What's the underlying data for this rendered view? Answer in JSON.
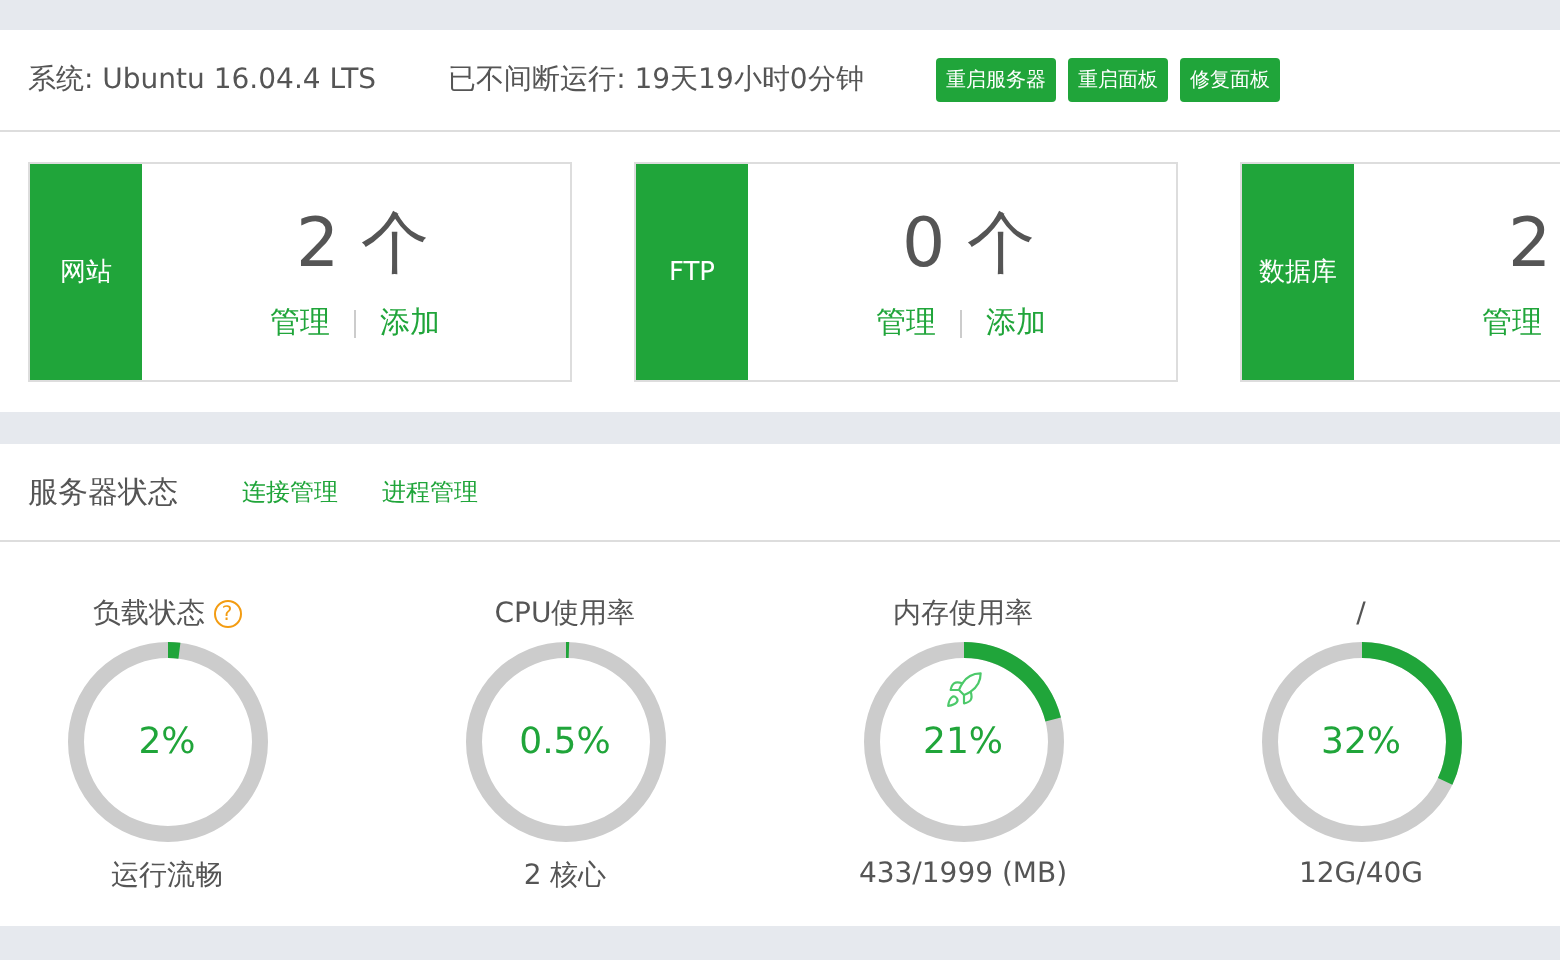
{
  "system_bar": {
    "system": "系统: Ubuntu 16.04.4 LTS",
    "uptime": "已不间断运行: 19天19小时0分钟",
    "buttons": [
      "重启服务器",
      "重启面板",
      "修复面板"
    ]
  },
  "cards": [
    {
      "label": "网站",
      "count": "2 个",
      "links": [
        "管理",
        "添加"
      ]
    },
    {
      "label": "FTP",
      "count": "0 个",
      "links": [
        "管理",
        "添加"
      ]
    },
    {
      "label": "数据库",
      "count": "2",
      "links": [
        "管理"
      ]
    }
  ],
  "status": {
    "title": "服务器状态",
    "links": [
      "连接管理",
      "进程管理"
    ],
    "gauges": [
      {
        "title": "负载状态",
        "help": "?",
        "level": 0.02,
        "value": "2%",
        "caption": "运行流畅",
        "rocket": false
      },
      {
        "title": "CPU使用率",
        "level": 0.005,
        "value": "0.5%",
        "caption": "2 核心",
        "rocket": false
      },
      {
        "title": "内存使用率",
        "level": 0.21,
        "value": "21%",
        "caption": "433/1999 (MB)",
        "rocket": true
      },
      {
        "title": "/",
        "level": 0.32,
        "value": "32%",
        "caption": "12G/40G",
        "rocket": false
      }
    ]
  }
}
